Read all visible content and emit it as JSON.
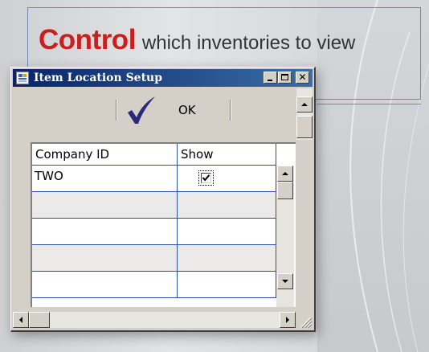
{
  "banner": {
    "headline_bold": "Control",
    "headline_rest": "which inventories to view"
  },
  "window": {
    "title": "Item Location Setup",
    "title_icon": "form-icon",
    "controls": {
      "minimize_icon": "minimize-icon",
      "maximize_icon": "maximize-icon",
      "close_glyph": "✕"
    }
  },
  "toolbar": {
    "ok_label": "OK",
    "ok_icon": "checkmark-icon"
  },
  "grid": {
    "columns": [
      "Company ID",
      "Show"
    ],
    "rows": [
      {
        "company_id": "TWO",
        "show": true
      },
      {
        "company_id": "",
        "show": null
      },
      {
        "company_id": "",
        "show": null
      },
      {
        "company_id": "",
        "show": null
      },
      {
        "company_id": "",
        "show": null
      }
    ]
  },
  "colors": {
    "title_bar_start": "#0a246a",
    "title_bar_end": "#3a6ea5",
    "headline_red": "#c8201f",
    "grid_lines": "#2b4fa0",
    "checkmark": "#2a2a7a"
  }
}
